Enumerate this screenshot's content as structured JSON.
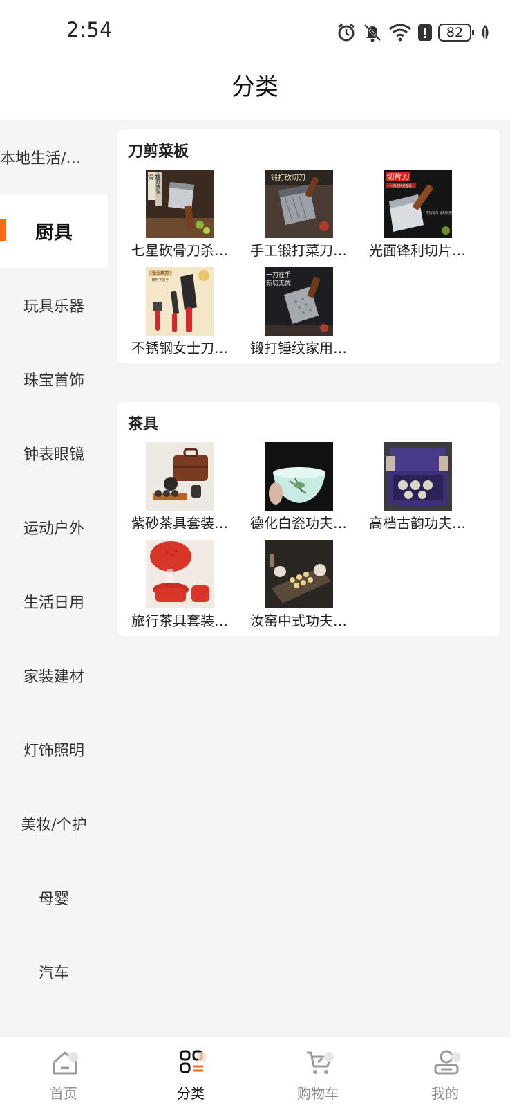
{
  "status": {
    "time": "2:54",
    "battery": "82",
    "icons": [
      "alarm-icon",
      "mute-icon",
      "wifi-icon",
      "alert-icon",
      "battery-icon",
      "leaf-icon"
    ]
  },
  "header": {
    "title": "分类"
  },
  "sidebar": {
    "active_color": "#ff6a1a",
    "items": [
      {
        "label": "本地生活/…"
      },
      {
        "label": "厨具"
      },
      {
        "label": "玩具乐器"
      },
      {
        "label": "珠宝首饰"
      },
      {
        "label": "钟表眼镜"
      },
      {
        "label": "运动户外"
      },
      {
        "label": "生活日用"
      },
      {
        "label": "家装建材"
      },
      {
        "label": "灯饰照明"
      },
      {
        "label": "美妆/个护"
      },
      {
        "label": "母婴"
      },
      {
        "label": "汽车"
      }
    ],
    "active_index": 1
  },
  "sections": [
    {
      "title": "刀剪菜板",
      "products": [
        {
          "name": "七星砍骨刀杀…",
          "image": "cleaver-knife-image"
        },
        {
          "name": "手工锻打菜刀…",
          "image": "forged-knife-image"
        },
        {
          "name": "光面锋利切片…",
          "image": "slicing-knife-image"
        },
        {
          "name": "不锈钢女士刀…",
          "image": "knife-set-image"
        },
        {
          "name": "锻打锤纹家用…",
          "image": "hammered-knife-image"
        }
      ]
    },
    {
      "title": "茶具",
      "products": [
        {
          "name": "紫砂茶具套装…",
          "image": "tea-case-image"
        },
        {
          "name": "德化白瓷功夫…",
          "image": "white-porcelain-bowl-image"
        },
        {
          "name": "高档古韵功夫…",
          "image": "gift-box-tea-set-image"
        },
        {
          "name": "旅行茶具套装…",
          "image": "red-tea-set-image"
        },
        {
          "name": "汝窑中式功夫…",
          "image": "ru-kiln-tea-set-image"
        }
      ]
    }
  ],
  "image_text": {
    "p0": [
      "砍骨刀",
      "手工锻打锋锐"
    ],
    "p1": [
      "锻打砍切刀"
    ],
    "p2": [
      "切片刀",
      "一刀切片更轻松",
      "不锈钢刀 锋利耐用"
    ],
    "p3": [
      "女士用刀",
      "锋利不易手"
    ],
    "p4": [
      "一刀在手",
      "斩切无忧"
    ]
  },
  "tabbar": {
    "active_color": "#ff6a1a",
    "tabs": [
      {
        "label": "首页",
        "icon": "home-icon"
      },
      {
        "label": "分类",
        "icon": "category-icon"
      },
      {
        "label": "购物车",
        "icon": "cart-icon"
      },
      {
        "label": "我的",
        "icon": "profile-icon"
      }
    ],
    "active_index": 1
  }
}
